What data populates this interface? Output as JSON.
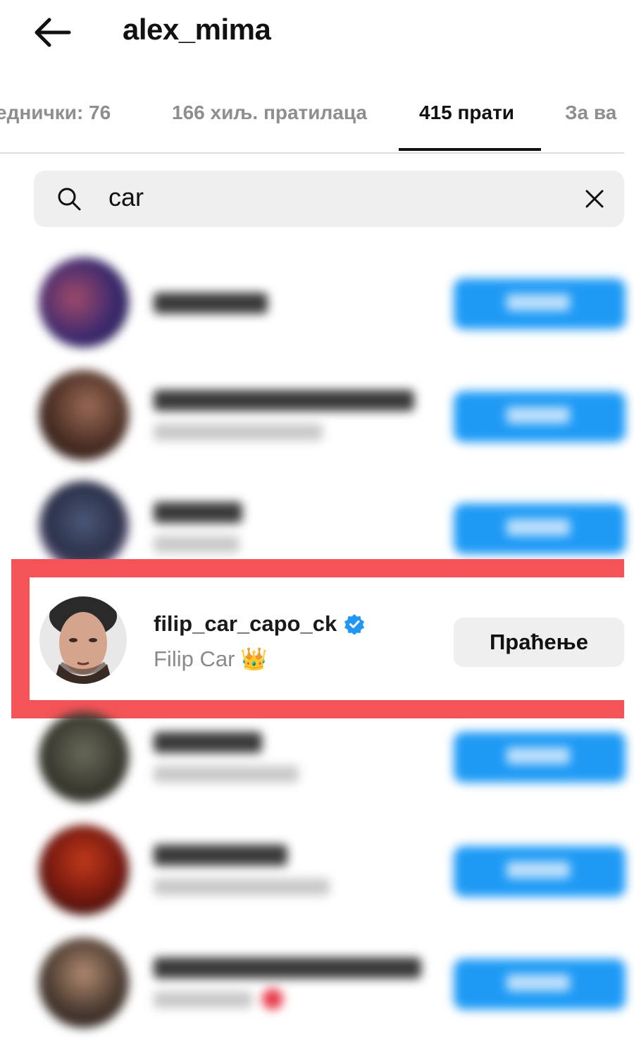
{
  "header": {
    "title": "alex_mima"
  },
  "tabs": [
    {
      "label": "еднички: 76"
    },
    {
      "label": "166 хиљ. пратилаца"
    },
    {
      "label": "415 прати"
    },
    {
      "label": "За ва"
    }
  ],
  "search": {
    "value": "car"
  },
  "highlighted_user": {
    "username": "filip_car_capo_ck",
    "display_name": "Filip Car",
    "emoji": "👑",
    "verified": true,
    "button_label": "Праћење"
  },
  "colors": {
    "highlight": "#f45458",
    "follow_blue": "#1e9af5",
    "verified_blue": "#2196f3"
  }
}
